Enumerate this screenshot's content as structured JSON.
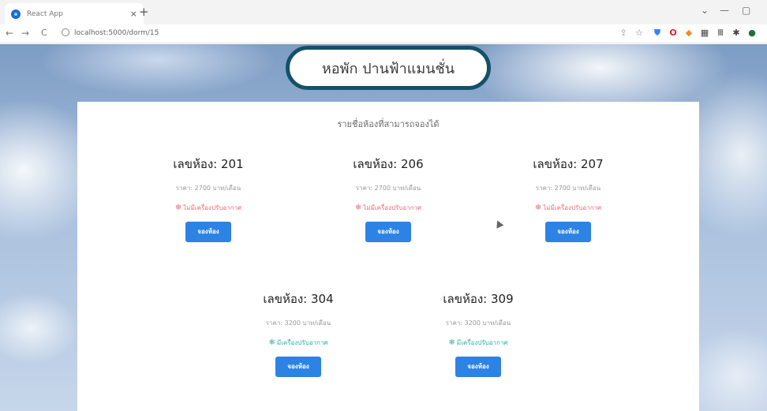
{
  "browser": {
    "tab_title": "React App",
    "tab_close": "×",
    "new_tab": "+",
    "url": "localhost:5000/dorm/15",
    "controls": {
      "chevron": "⌄",
      "minimize": "—",
      "restore": "▢"
    },
    "nav": {
      "back": "←",
      "forward": "→",
      "reload": "C"
    }
  },
  "page": {
    "title": "หอพัก ปานฟ้าแมนชั่น",
    "heading": "รายชื่อห้องที่สามารถจองได้",
    "rooms": [
      {
        "label": "เลขห้อง: 201",
        "price": "ราคา: 2700 บาท/เดือน",
        "aircon": "ไม่มีเครื่องปรับอากาศ",
        "book": "จองห้อง"
      },
      {
        "label": "เลขห้อง: 206",
        "price": "ราคา: 2700 บาท/เดือน",
        "aircon": "ไม่มีเครื่องปรับอากาศ",
        "book": "จองห้อง"
      },
      {
        "label": "เลขห้อง: 207",
        "price": "ราคา: 2700 บาท/เดือน",
        "aircon": "ไม่มีเครื่องปรับอากาศ",
        "book": "จองห้อง"
      },
      {
        "label": "เลขห้อง: 304",
        "price": "ราคา: 3200 บาท/เดือน",
        "aircon": "มีเครื่องปรับอากาศ",
        "book": "จองห้อง"
      },
      {
        "label": "เลขห้อง: 309",
        "price": "ราคา: 3200 บาท/เดือน",
        "aircon": "มีเครื่องปรับอากาศ",
        "book": "จองห้อง"
      }
    ]
  },
  "colors": {
    "no_aircon": "#f06b7a",
    "has_aircon": "#2bb3a0",
    "book_button": "#2d83e4",
    "pill_border": "#14506a"
  },
  "icons": {
    "snowflake": "❄"
  }
}
